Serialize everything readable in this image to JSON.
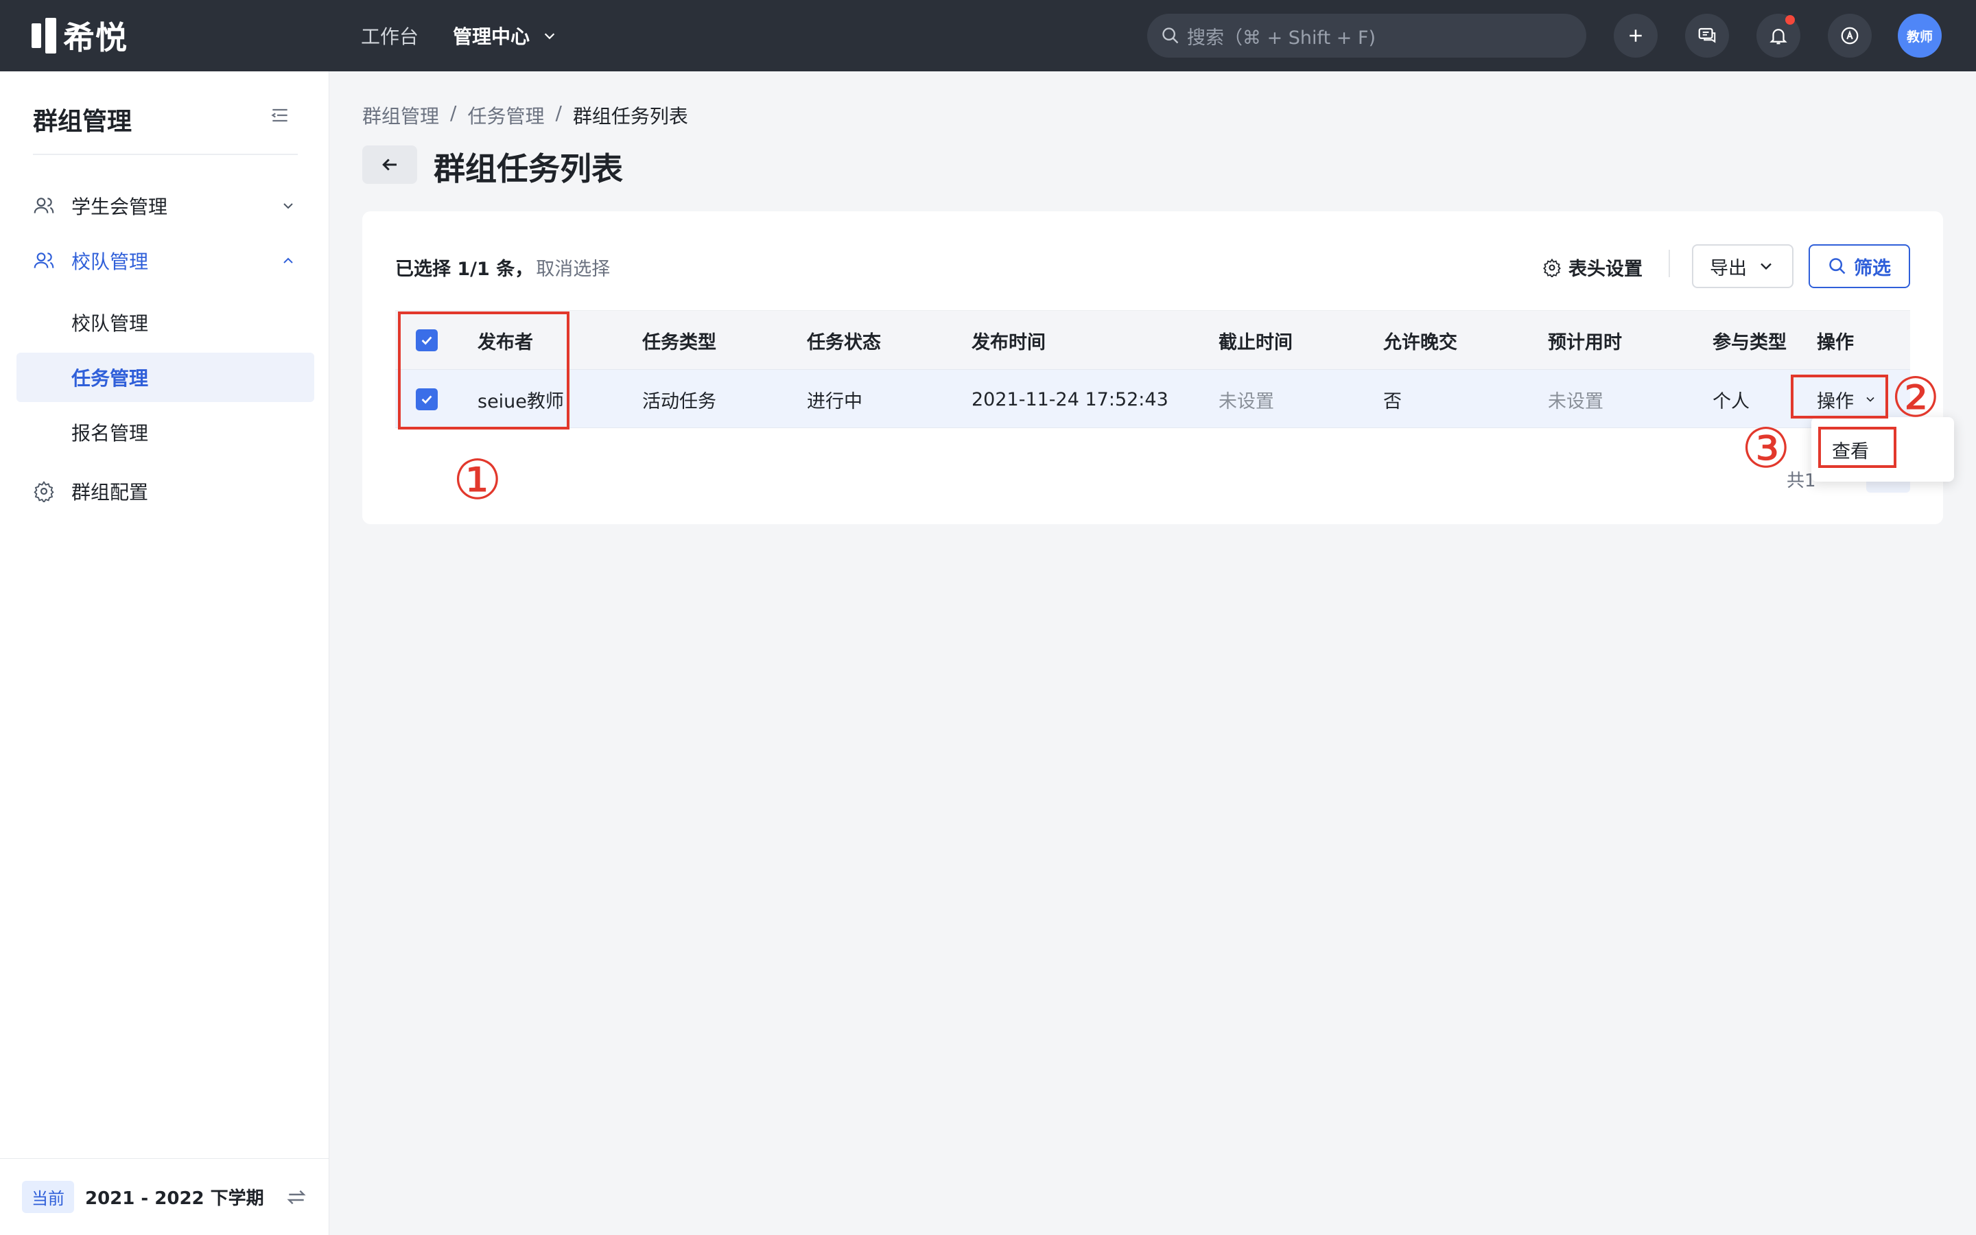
{
  "topbar": {
    "brand": "希悦",
    "nav": [
      {
        "label": "工作台",
        "active": false
      },
      {
        "label": "管理中心",
        "active": true
      }
    ],
    "search_placeholder": "搜索（⌘ + Shift + F)",
    "avatar": "教师"
  },
  "sidebar": {
    "title": "群组管理",
    "menu": {
      "student_union": "学生会管理",
      "team": "校队管理",
      "team_sub": [
        "校队管理",
        "任务管理",
        "报名管理"
      ],
      "config": "群组配置"
    },
    "footer": {
      "badge": "当前",
      "term": "2021 - 2022 下学期"
    }
  },
  "breadcrumb": [
    "群组管理",
    "/",
    "任务管理",
    "/",
    "群组任务列表"
  ],
  "page_title": "群组任务列表",
  "toolbar": {
    "selected_text": "已选择 1/1 条，",
    "cancel_select": "取消选择",
    "header_settings": "表头设置",
    "export": "导出",
    "filter": "筛选"
  },
  "table": {
    "headers": [
      "发布者",
      "任务类型",
      "任务状态",
      "发布时间",
      "截止时间",
      "允许晚交",
      "预计用时",
      "参与类型",
      "操作"
    ],
    "rows": [
      {
        "checked": true,
        "publisher": "seiue教师",
        "type": "活动任务",
        "status": "进行中",
        "published": "2021-11-24 17:52:43",
        "deadline": "未设置",
        "late": "否",
        "duration": "未设置",
        "participation": "个人",
        "action": "操作"
      }
    ]
  },
  "pager": {
    "total_partial": "共1"
  },
  "dropdown": {
    "view": "查看"
  },
  "annotations": {
    "n1": "①",
    "n2": "②",
    "n3": "③"
  },
  "colors": {
    "accent": "#2f5fd9",
    "annotation": "#e2382c",
    "topbar": "#2b3039"
  }
}
